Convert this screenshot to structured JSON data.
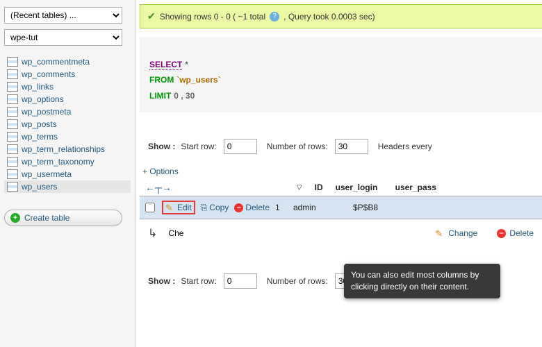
{
  "sidebar": {
    "recent_tables": "(Recent tables) ...",
    "database": "wpe-tut",
    "tables": [
      "wp_commentmeta",
      "wp_comments",
      "wp_links",
      "wp_options",
      "wp_postmeta",
      "wp_posts",
      "wp_terms",
      "wp_term_relationships",
      "wp_term_taxonomy",
      "wp_usermeta",
      "wp_users"
    ],
    "create_table": "Create table"
  },
  "status": {
    "text1": "Showing rows 0 - 0 ( ~1 total",
    "text2": ", Query took 0.0003 sec)"
  },
  "sql": {
    "select": "SELECT",
    "star": " *",
    "from": "FROM",
    "table": " `wp_users`",
    "limit": "LIMIT",
    "limit_vals": " 0 , 30"
  },
  "show": {
    "label": "Show :",
    "start_row": "Start row:",
    "start_val": "0",
    "num_rows": "Number of rows:",
    "num_val": "30",
    "headers_every": "Headers every"
  },
  "main": {
    "options": "+ Options"
  },
  "table": {
    "cols": [
      "ID",
      "user_login",
      "user_pass"
    ]
  },
  "row": {
    "edit": "Edit",
    "copy": "Copy",
    "delete": "Delete",
    "id": "1",
    "user_login": "admin",
    "user_pass": "$P$B8"
  },
  "footer": {
    "check": "Che",
    "change": "Change",
    "delete": "Delete"
  },
  "tooltip": {
    "text": "You can also edit most columns by clicking directly on their content."
  }
}
